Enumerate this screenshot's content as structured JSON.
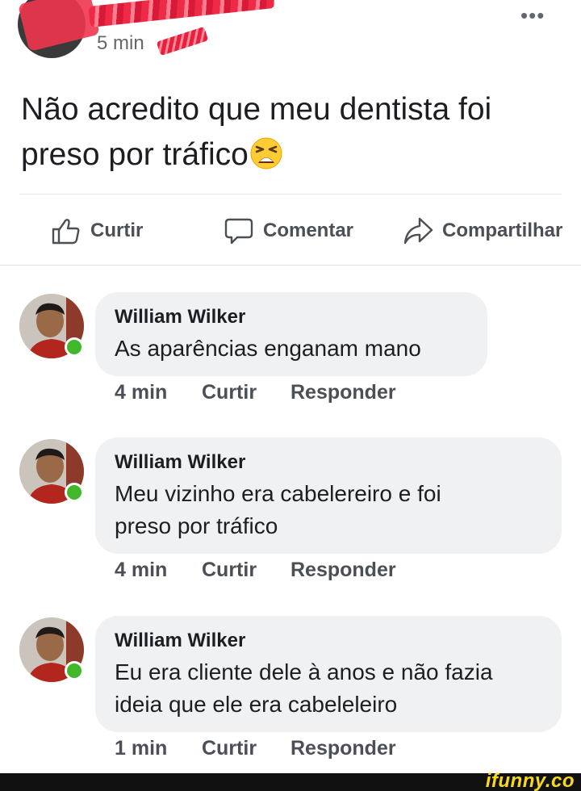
{
  "post": {
    "time": "5 min",
    "more_icon": "more-dots-icon",
    "text": "Não acredito que meu dentista foi preso por tráfico",
    "emoji": "tired-face-emoji"
  },
  "actions": [
    {
      "label": "Curtir",
      "icon": "thumbs-up-icon"
    },
    {
      "label": "Comentar",
      "icon": "comment-bubble-icon"
    },
    {
      "label": "Compartilhar",
      "icon": "share-arrow-icon"
    }
  ],
  "comments": [
    {
      "author": "William Wilker",
      "lines": [
        "As aparências enganam mano"
      ],
      "time": "4 min",
      "like": "Curtir",
      "reply": "Responder"
    },
    {
      "author": "William Wilker",
      "lines": [
        "Meu vizinho era cabelereiro e foi",
        "preso por tráfico"
      ],
      "time": "4 min",
      "like": "Curtir",
      "reply": "Responder"
    },
    {
      "author": "William Wilker",
      "lines": [
        "Eu era cliente dele à anos e não fazia",
        "ideia que ele era cabeleleiro"
      ],
      "time": "1 min",
      "like": "Curtir",
      "reply": "Responder"
    }
  ],
  "watermark": "ifunny.co",
  "colors": {
    "online": "#42b72a",
    "bubble": "#eff1f3",
    "watermark": "#f7d820",
    "redaction": "#ee2a46"
  }
}
